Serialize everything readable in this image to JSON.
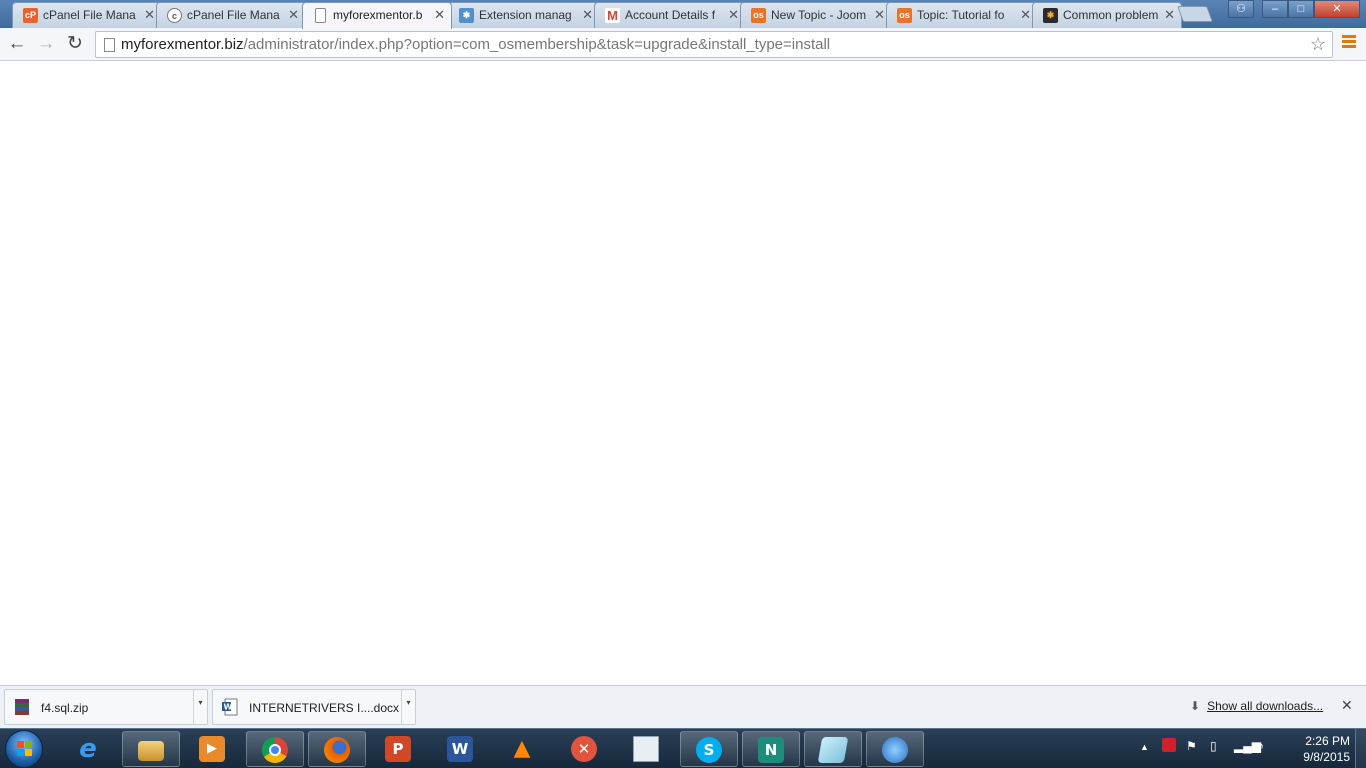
{
  "browser": {
    "tabs": [
      {
        "title": "cPanel File Mana",
        "icon": "cpanel-icon",
        "color": "#e8632b",
        "active": false
      },
      {
        "title": "cPanel File Mana",
        "icon": "cpanel-c-icon",
        "color": "#7a7a7a",
        "active": false
      },
      {
        "title": "myforexmentor.b",
        "icon": "page-icon",
        "color": "#ffffff",
        "active": true
      },
      {
        "title": "Extension manag",
        "icon": "joomla-icon",
        "color": "#5091cd",
        "active": false
      },
      {
        "title": "Account Details f",
        "icon": "gmail-icon",
        "color": "#d14836",
        "active": false
      },
      {
        "title": "New Topic - Joom",
        "icon": "os-icon",
        "color": "#e8742c",
        "active": false
      },
      {
        "title": "Topic: Tutorial fo",
        "icon": "os-icon",
        "color": "#e8742c",
        "active": false
      },
      {
        "title": "Common problem",
        "icon": "joomla-icon",
        "color": "#2b2b2b",
        "active": false
      }
    ],
    "window_controls": {
      "minimize": "–",
      "maximize": "□",
      "close": "✕"
    },
    "toolbar": {
      "back": "←",
      "forward": "→",
      "reload": "↻",
      "url_host": "myforexmentor.biz",
      "url_path": "/administrator/index.php?option=com_osmembership&task=upgrade&install_type=install",
      "star": "☆"
    }
  },
  "downloads": {
    "items": [
      {
        "name": "f4.sql.zip",
        "icon": "winrar-archive-icon"
      },
      {
        "name": "INTERNETRIVERS I....docx",
        "icon": "word-document-icon"
      }
    ],
    "dropdown": "▾",
    "show_all": "Show all downloads...",
    "close": "✕"
  },
  "taskbar": {
    "apps": [
      {
        "name": "internet-explorer-icon",
        "glyph": "e",
        "color": "#1e7ad6",
        "open": false
      },
      {
        "name": "file-explorer-icon",
        "glyph": "",
        "color": "#d9a43a",
        "open": true
      },
      {
        "name": "media-player-icon",
        "glyph": "▶",
        "color": "#e88a2a",
        "open": false
      },
      {
        "name": "chrome-icon",
        "glyph": "",
        "color": "#dd4b39",
        "open": true
      },
      {
        "name": "firefox-icon",
        "glyph": "",
        "color": "#e66000",
        "open": true
      },
      {
        "name": "powerpoint-icon",
        "glyph": "P",
        "color": "#d24726",
        "open": false
      },
      {
        "name": "word-icon",
        "glyph": "W",
        "color": "#2b579a",
        "open": false
      },
      {
        "name": "vlc-icon",
        "glyph": "▲",
        "color": "#ff8800",
        "open": false
      },
      {
        "name": "crossover-icon",
        "glyph": "✕",
        "color": "#e0533d",
        "open": false
      },
      {
        "name": "notepad-window-icon",
        "glyph": "",
        "color": "#d8e4ee",
        "open": false
      },
      {
        "name": "skype-icon",
        "glyph": "S",
        "color": "#00aff0",
        "open": true
      },
      {
        "name": "app-n-icon",
        "glyph": "N",
        "color": "#1e8c7a",
        "open": true
      },
      {
        "name": "sticky-icon",
        "glyph": "",
        "color": "#9fd4e8",
        "open": true
      },
      {
        "name": "network-globe-icon",
        "glyph": "◉",
        "color": "#2c6fc2",
        "open": true
      }
    ],
    "tray": {
      "expand": "▲"
    },
    "clock": {
      "time": "2:26 PM",
      "date": "9/8/2015"
    }
  }
}
